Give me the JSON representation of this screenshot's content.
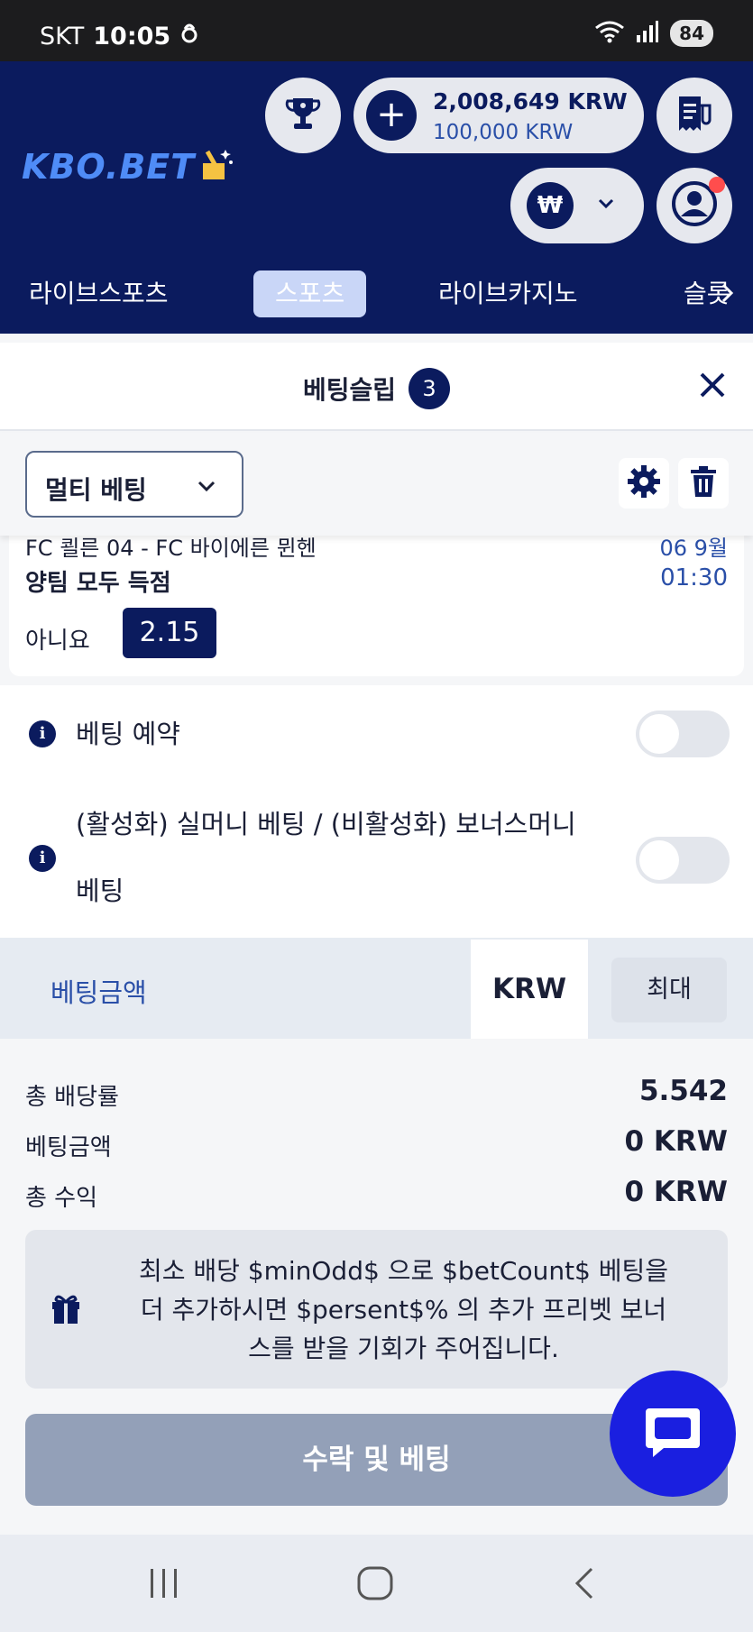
{
  "status_bar": {
    "carrier": "SKT",
    "time": "10:05",
    "battery": "84"
  },
  "header": {
    "logo": "KBO.BET",
    "balance_main": "2,008,649 KRW",
    "balance_sub": "100,000 KRW",
    "currency_symbol": "₩",
    "colors": {
      "primary": "#0b1b5e",
      "accent": "#4f8cf7",
      "notification": "#ff4d4d"
    }
  },
  "nav": {
    "tabs": [
      {
        "label": "라이브스포츠",
        "active": false
      },
      {
        "label": "스포츠",
        "active": true
      },
      {
        "label": "라이브카지노",
        "active": false
      },
      {
        "label": "슬롯",
        "active": false
      }
    ]
  },
  "betslip": {
    "title": "베팅슬립",
    "count": "3",
    "mode": "멀티 베팅",
    "card": {
      "match": "FC 쾰른 04 - FC 바이에른 뮌헨",
      "date": "06 9월",
      "market": "양팀 모두 득점",
      "time": "01:30",
      "pick": "아니요",
      "odd": "2.15"
    }
  },
  "options": {
    "reserve_label": "베팅 예약",
    "realmoney_label_line1": "(활성화) 실머니 베팅 / (비활성화) 보너스머니",
    "realmoney_label_line2": "베팅",
    "reserve_on": false,
    "realmoney_on": false
  },
  "amount": {
    "label": "베팅금액",
    "currency": "KRW",
    "max_label": "최대"
  },
  "summary": {
    "total_odds_label": "총 배당률",
    "total_odds_value": "5.542",
    "stake_label": "베팅금액",
    "stake_value": "0 KRW",
    "profit_label": "총 수익",
    "profit_value": "0 KRW"
  },
  "promo": {
    "line1": "최소 배당 $minOdd$ 으로 $betCount$ 베팅을",
    "line2": "더 추가하시면 $persent$% 의 추가 프리벳 보너",
    "line3": "스를 받을 기회가 주어집니다."
  },
  "actions": {
    "accept_label": "수락 및 베팅"
  }
}
